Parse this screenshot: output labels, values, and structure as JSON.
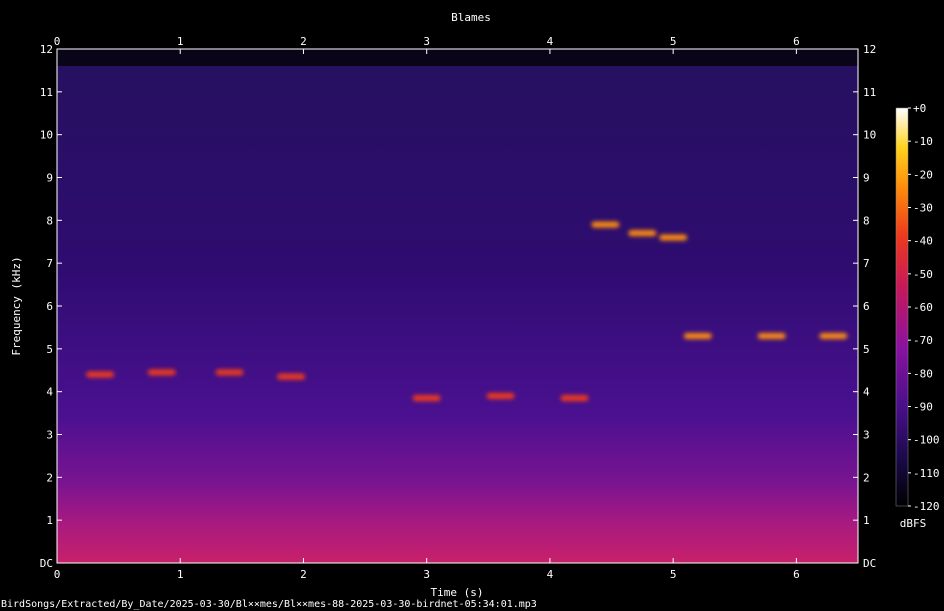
{
  "chart_data": {
    "type": "heatmap",
    "title": "Blames",
    "xlabel": "Time (s)",
    "ylabel": "Frequency (kHz)",
    "x_ticks": [
      "0",
      "1",
      "2",
      "3",
      "4",
      "5",
      "6"
    ],
    "x_tick_values": [
      0,
      1,
      2,
      3,
      4,
      5,
      6
    ],
    "xlim": [
      0,
      6.5
    ],
    "y_ticks": [
      "DC",
      "1",
      "2",
      "3",
      "4",
      "5",
      "6",
      "7",
      "8",
      "9",
      "10",
      "11",
      "12"
    ],
    "y_tick_values": [
      0,
      1,
      2,
      3,
      4,
      5,
      6,
      7,
      8,
      9,
      10,
      11,
      12
    ],
    "ylim": [
      0,
      12
    ],
    "colorbar": {
      "unit": "dBFS",
      "ticks": [
        "+0",
        "-10",
        "-20",
        "-30",
        "-40",
        "-50",
        "-60",
        "-70",
        "-80",
        "-90",
        "-100",
        "-110",
        "-120"
      ],
      "tick_values": [
        0,
        -10,
        -20,
        -30,
        -40,
        -50,
        -60,
        -70,
        -80,
        -90,
        -100,
        -110,
        -120
      ],
      "range": [
        -120,
        0
      ],
      "colormap": [
        "#000000",
        "#1a0a4a",
        "#4a0f8a",
        "#8a12a0",
        "#c8185a",
        "#ee3a1c",
        "#ff8c0a",
        "#ffd21e",
        "#ffffff"
      ]
    },
    "events": [
      {
        "t": 0.35,
        "f": 4.4,
        "level_db": -45
      },
      {
        "t": 0.85,
        "f": 4.45,
        "level_db": -45
      },
      {
        "t": 1.4,
        "f": 4.45,
        "level_db": -45
      },
      {
        "t": 1.9,
        "f": 4.35,
        "level_db": -50
      },
      {
        "t": 3.0,
        "f": 3.85,
        "level_db": -45
      },
      {
        "t": 3.6,
        "f": 3.9,
        "level_db": -45
      },
      {
        "t": 4.2,
        "f": 3.85,
        "level_db": -45
      },
      {
        "t": 4.45,
        "f": 7.9,
        "level_db": -30
      },
      {
        "t": 4.75,
        "f": 7.7,
        "level_db": -30
      },
      {
        "t": 5.0,
        "f": 7.6,
        "level_db": -35
      },
      {
        "t": 5.2,
        "f": 5.3,
        "level_db": -30
      },
      {
        "t": 5.8,
        "f": 5.3,
        "level_db": -35
      },
      {
        "t": 6.3,
        "f": 5.3,
        "level_db": -35
      }
    ]
  },
  "footer_path": "BirdSongs/Extracted/By_Date/2025-03-30/Bl××mes/Bl××mes-88-2025-03-30-birdnet-05:34:01.mp3"
}
